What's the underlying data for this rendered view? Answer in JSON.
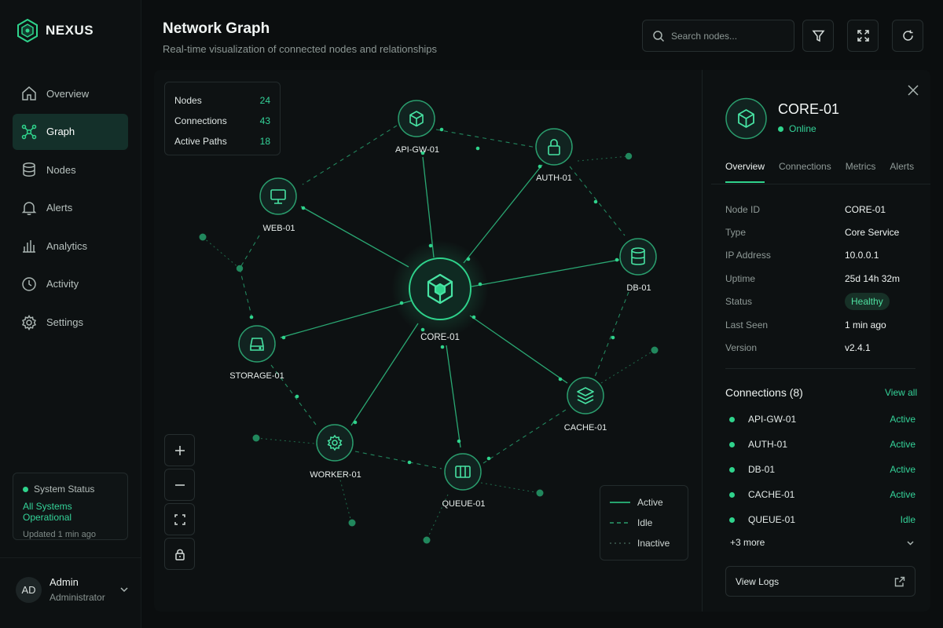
{
  "brand": {
    "name": "NEXUS"
  },
  "nav": [
    {
      "id": "overview",
      "label": "Overview",
      "icon": "home-icon",
      "active": false
    },
    {
      "id": "graph",
      "label": "Graph",
      "icon": "graph-icon",
      "active": true
    },
    {
      "id": "nodes",
      "label": "Nodes",
      "icon": "database-icon",
      "active": false
    },
    {
      "id": "alerts",
      "label": "Alerts",
      "icon": "bell-icon",
      "active": false
    },
    {
      "id": "analytics",
      "label": "Analytics",
      "icon": "bar-chart-icon",
      "active": false
    },
    {
      "id": "activity",
      "label": "Activity",
      "icon": "clock-icon",
      "active": false
    },
    {
      "id": "settings",
      "label": "Settings",
      "icon": "gear-icon",
      "active": false
    }
  ],
  "system_status": {
    "title": "System Status",
    "message": "All Systems Operational",
    "updated": "Updated 1 min ago"
  },
  "user": {
    "initials": "AD",
    "name": "Admin",
    "role": "Administrator"
  },
  "header": {
    "title": "Network Graph",
    "subtitle": "Real-time visualization of connected nodes and relationships",
    "search_placeholder": "Search nodes..."
  },
  "stats": [
    {
      "label": "Nodes",
      "value": "24"
    },
    {
      "label": "Connections",
      "value": "43"
    },
    {
      "label": "Active Paths",
      "value": "18"
    }
  ],
  "graph": {
    "nodes": [
      {
        "id": "core",
        "label": "CORE-01",
        "icon": "cube-icon",
        "primary": true
      },
      {
        "id": "apigw",
        "label": "API-GW-01",
        "icon": "cube-icon"
      },
      {
        "id": "auth",
        "label": "AUTH-01",
        "icon": "lock-icon"
      },
      {
        "id": "web",
        "label": "WEB-01",
        "icon": "monitor-icon"
      },
      {
        "id": "db",
        "label": "DB-01",
        "icon": "database-icon"
      },
      {
        "id": "storage",
        "label": "STORAGE-01",
        "icon": "storage-icon"
      },
      {
        "id": "cache",
        "label": "CACHE-01",
        "icon": "layers-icon"
      },
      {
        "id": "worker",
        "label": "WORKER-01",
        "icon": "gear-icon"
      },
      {
        "id": "queue",
        "label": "QUEUE-01",
        "icon": "queue-icon"
      }
    ]
  },
  "legend": [
    {
      "label": "Active",
      "style": "solid"
    },
    {
      "label": "Idle",
      "style": "dashed"
    },
    {
      "label": "Inactive",
      "style": "dotted"
    }
  ],
  "detail": {
    "name": "CORE-01",
    "status": "Online",
    "tabs": [
      "Overview",
      "Connections",
      "Metrics",
      "Alerts"
    ],
    "active_tab": "Overview",
    "properties": [
      {
        "key": "Node ID",
        "value": "CORE-01"
      },
      {
        "key": "Type",
        "value": "Core Service"
      },
      {
        "key": "IP Address",
        "value": "10.0.0.1"
      },
      {
        "key": "Uptime",
        "value": "25d 14h 32m"
      },
      {
        "key": "Status",
        "value": "Healthy",
        "badge": true
      },
      {
        "key": "Last Seen",
        "value": "1 min ago"
      },
      {
        "key": "Version",
        "value": "v2.4.1"
      }
    ],
    "connections_title": "Connections (8)",
    "view_all": "View all",
    "connections": [
      {
        "name": "API-GW-01",
        "state": "Active"
      },
      {
        "name": "AUTH-01",
        "state": "Active"
      },
      {
        "name": "DB-01",
        "state": "Active"
      },
      {
        "name": "CACHE-01",
        "state": "Active"
      },
      {
        "name": "QUEUE-01",
        "state": "Idle"
      }
    ],
    "more": "+3 more",
    "view_logs": "View Logs"
  },
  "colors": {
    "accent": "#2fd38c",
    "background": "#0b0e0f",
    "panel": "#0d1112"
  }
}
